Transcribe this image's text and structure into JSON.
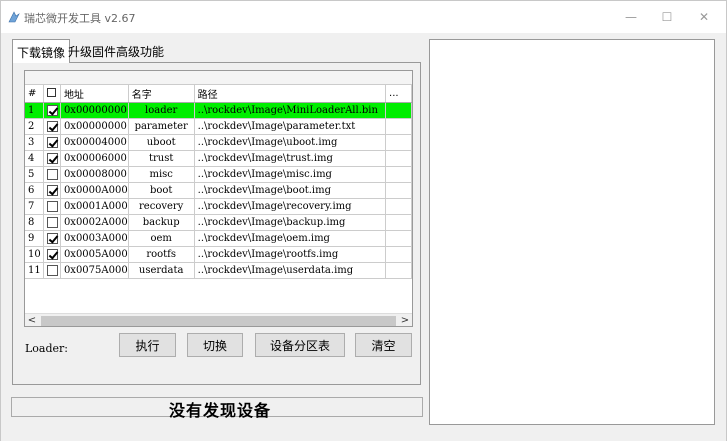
{
  "window": {
    "title": "瑞芯微开发工具 v2.67",
    "controls": {
      "minimize": "—",
      "maximize": "☐",
      "close": "✕"
    }
  },
  "tabs": [
    {
      "label": "下载镜像",
      "active": true
    },
    {
      "label": "升级固件",
      "active": false
    },
    {
      "label": "高级功能",
      "active": false
    }
  ],
  "table": {
    "headers": {
      "num": "#",
      "address": "地址",
      "name": "名字",
      "path": "路径",
      "more": "..."
    },
    "rows": [
      {
        "num": "1",
        "checked": true,
        "address": "0x00000000",
        "name": "loader",
        "path": "..\\rockdev\\Image\\MiniLoaderAll.bin",
        "selected": true
      },
      {
        "num": "2",
        "checked": true,
        "address": "0x00000000",
        "name": "parameter",
        "path": "..\\rockdev\\Image\\parameter.txt",
        "selected": false
      },
      {
        "num": "3",
        "checked": true,
        "address": "0x00004000",
        "name": "uboot",
        "path": "..\\rockdev\\Image\\uboot.img",
        "selected": false
      },
      {
        "num": "4",
        "checked": true,
        "address": "0x00006000",
        "name": "trust",
        "path": "..\\rockdev\\Image\\trust.img",
        "selected": false
      },
      {
        "num": "5",
        "checked": false,
        "address": "0x00008000",
        "name": "misc",
        "path": "..\\rockdev\\Image\\misc.img",
        "selected": false
      },
      {
        "num": "6",
        "checked": true,
        "address": "0x0000A000",
        "name": "boot",
        "path": "..\\rockdev\\Image\\boot.img",
        "selected": false
      },
      {
        "num": "7",
        "checked": false,
        "address": "0x0001A000",
        "name": "recovery",
        "path": "..\\rockdev\\Image\\recovery.img",
        "selected": false
      },
      {
        "num": "8",
        "checked": false,
        "address": "0x0002A000",
        "name": "backup",
        "path": "..\\rockdev\\Image\\backup.img",
        "selected": false
      },
      {
        "num": "9",
        "checked": true,
        "address": "0x0003A000",
        "name": "oem",
        "path": "..\\rockdev\\Image\\oem.img",
        "selected": false
      },
      {
        "num": "10",
        "checked": true,
        "address": "0x0005A000",
        "name": "rootfs",
        "path": "..\\rockdev\\Image\\rootfs.img",
        "selected": false
      },
      {
        "num": "11",
        "checked": false,
        "address": "0x0075A000",
        "name": "userdata",
        "path": "..\\rockdev\\Image\\userdata.img",
        "selected": false
      }
    ]
  },
  "scroll": {
    "left": "<",
    "right": ">"
  },
  "loader_label": "Loader:",
  "buttons": {
    "run": "执行",
    "switch": "切换",
    "partition_table": "设备分区表",
    "clear": "清空"
  },
  "status": "没有发现设备",
  "colors": {
    "selected_row": "#00ee00",
    "window_bg": "#f0f0f0"
  }
}
